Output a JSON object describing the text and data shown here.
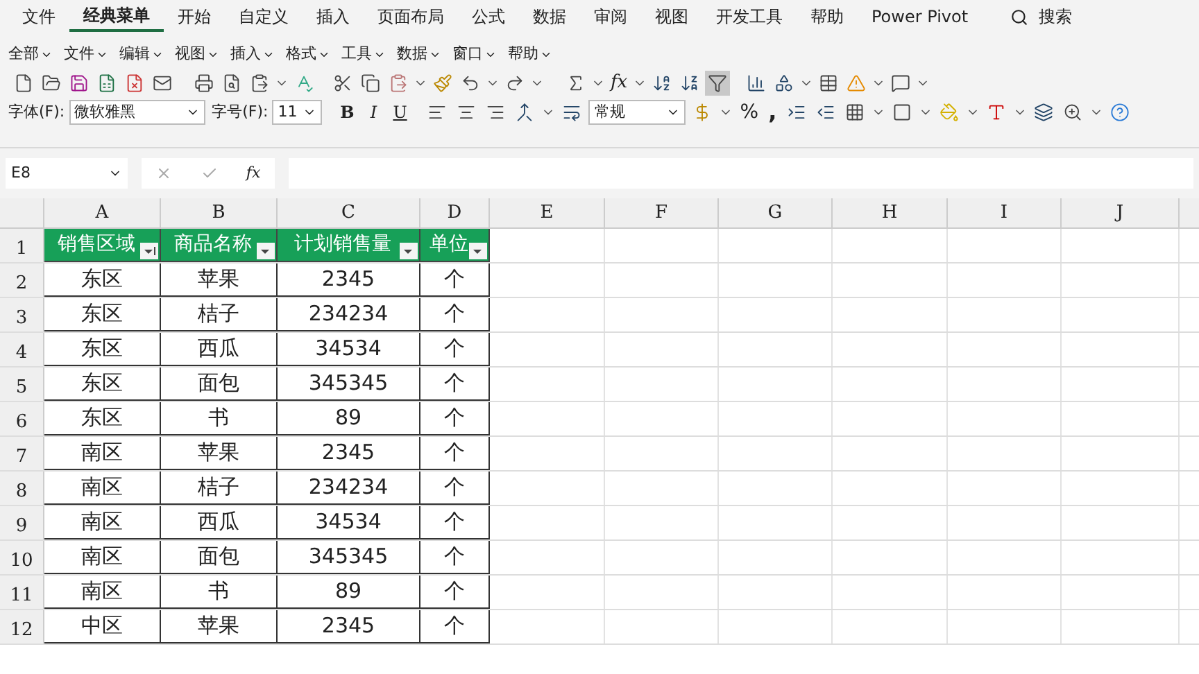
{
  "tabs": [
    {
      "label": "文件",
      "selected": false
    },
    {
      "label": "经典菜单",
      "selected": true
    },
    {
      "label": "开始",
      "selected": false
    },
    {
      "label": "自定义",
      "selected": false
    },
    {
      "label": "插入",
      "selected": false
    },
    {
      "label": "页面布局",
      "selected": false
    },
    {
      "label": "公式",
      "selected": false
    },
    {
      "label": "数据",
      "selected": false
    },
    {
      "label": "审阅",
      "selected": false
    },
    {
      "label": "视图",
      "selected": false
    },
    {
      "label": "开发工具",
      "selected": false
    },
    {
      "label": "帮助",
      "selected": false
    },
    {
      "label": "Power Pivot",
      "selected": false
    }
  ],
  "search": {
    "label": "搜索"
  },
  "menus": [
    "全部",
    "文件",
    "编辑",
    "视图",
    "插入",
    "格式",
    "工具",
    "数据",
    "窗口",
    "帮助"
  ],
  "toolbar": {
    "fx": "fx",
    "font_label": "字体(F):",
    "font": "微软雅黑",
    "size_label": "字号(F):",
    "size": "11",
    "format_buttons": [
      "B",
      "I",
      "U"
    ],
    "number_format": "常规",
    "percent": "%",
    "comma": ","
  },
  "formula_bar": {
    "name_box": "E8",
    "fx": "fx"
  },
  "sheet": {
    "columns": [
      "A",
      "B",
      "C",
      "D",
      "E",
      "F",
      "G",
      "H",
      "I",
      "J"
    ],
    "header": [
      {
        "label": "销售区域",
        "sorted": true
      },
      {
        "label": "商品名称",
        "sorted": false
      },
      {
        "label": "计划销售量",
        "sorted": false
      },
      {
        "label": "单位",
        "sorted": false
      }
    ],
    "rows": [
      {
        "number": "1"
      },
      {
        "number": "2",
        "cells": [
          "东区",
          "苹果",
          "2345",
          "个"
        ]
      },
      {
        "number": "3",
        "cells": [
          "东区",
          "桔子",
          "234234",
          "个"
        ]
      },
      {
        "number": "4",
        "cells": [
          "东区",
          "西瓜",
          "34534",
          "个"
        ]
      },
      {
        "number": "5",
        "cells": [
          "东区",
          "面包",
          "345345",
          "个"
        ]
      },
      {
        "number": "6",
        "cells": [
          "东区",
          "书",
          "89",
          "个"
        ]
      },
      {
        "number": "7",
        "cells": [
          "南区",
          "苹果",
          "2345",
          "个"
        ]
      },
      {
        "number": "8",
        "cells": [
          "南区",
          "桔子",
          "234234",
          "个"
        ]
      },
      {
        "number": "9",
        "cells": [
          "南区",
          "西瓜",
          "34534",
          "个"
        ]
      },
      {
        "number": "10",
        "cells": [
          "南区",
          "面包",
          "345345",
          "个"
        ]
      },
      {
        "number": "11",
        "cells": [
          "南区",
          "书",
          "89",
          "个"
        ]
      },
      {
        "number": "12",
        "cells": [
          "中区",
          "苹果",
          "2345",
          "个"
        ]
      }
    ]
  }
}
